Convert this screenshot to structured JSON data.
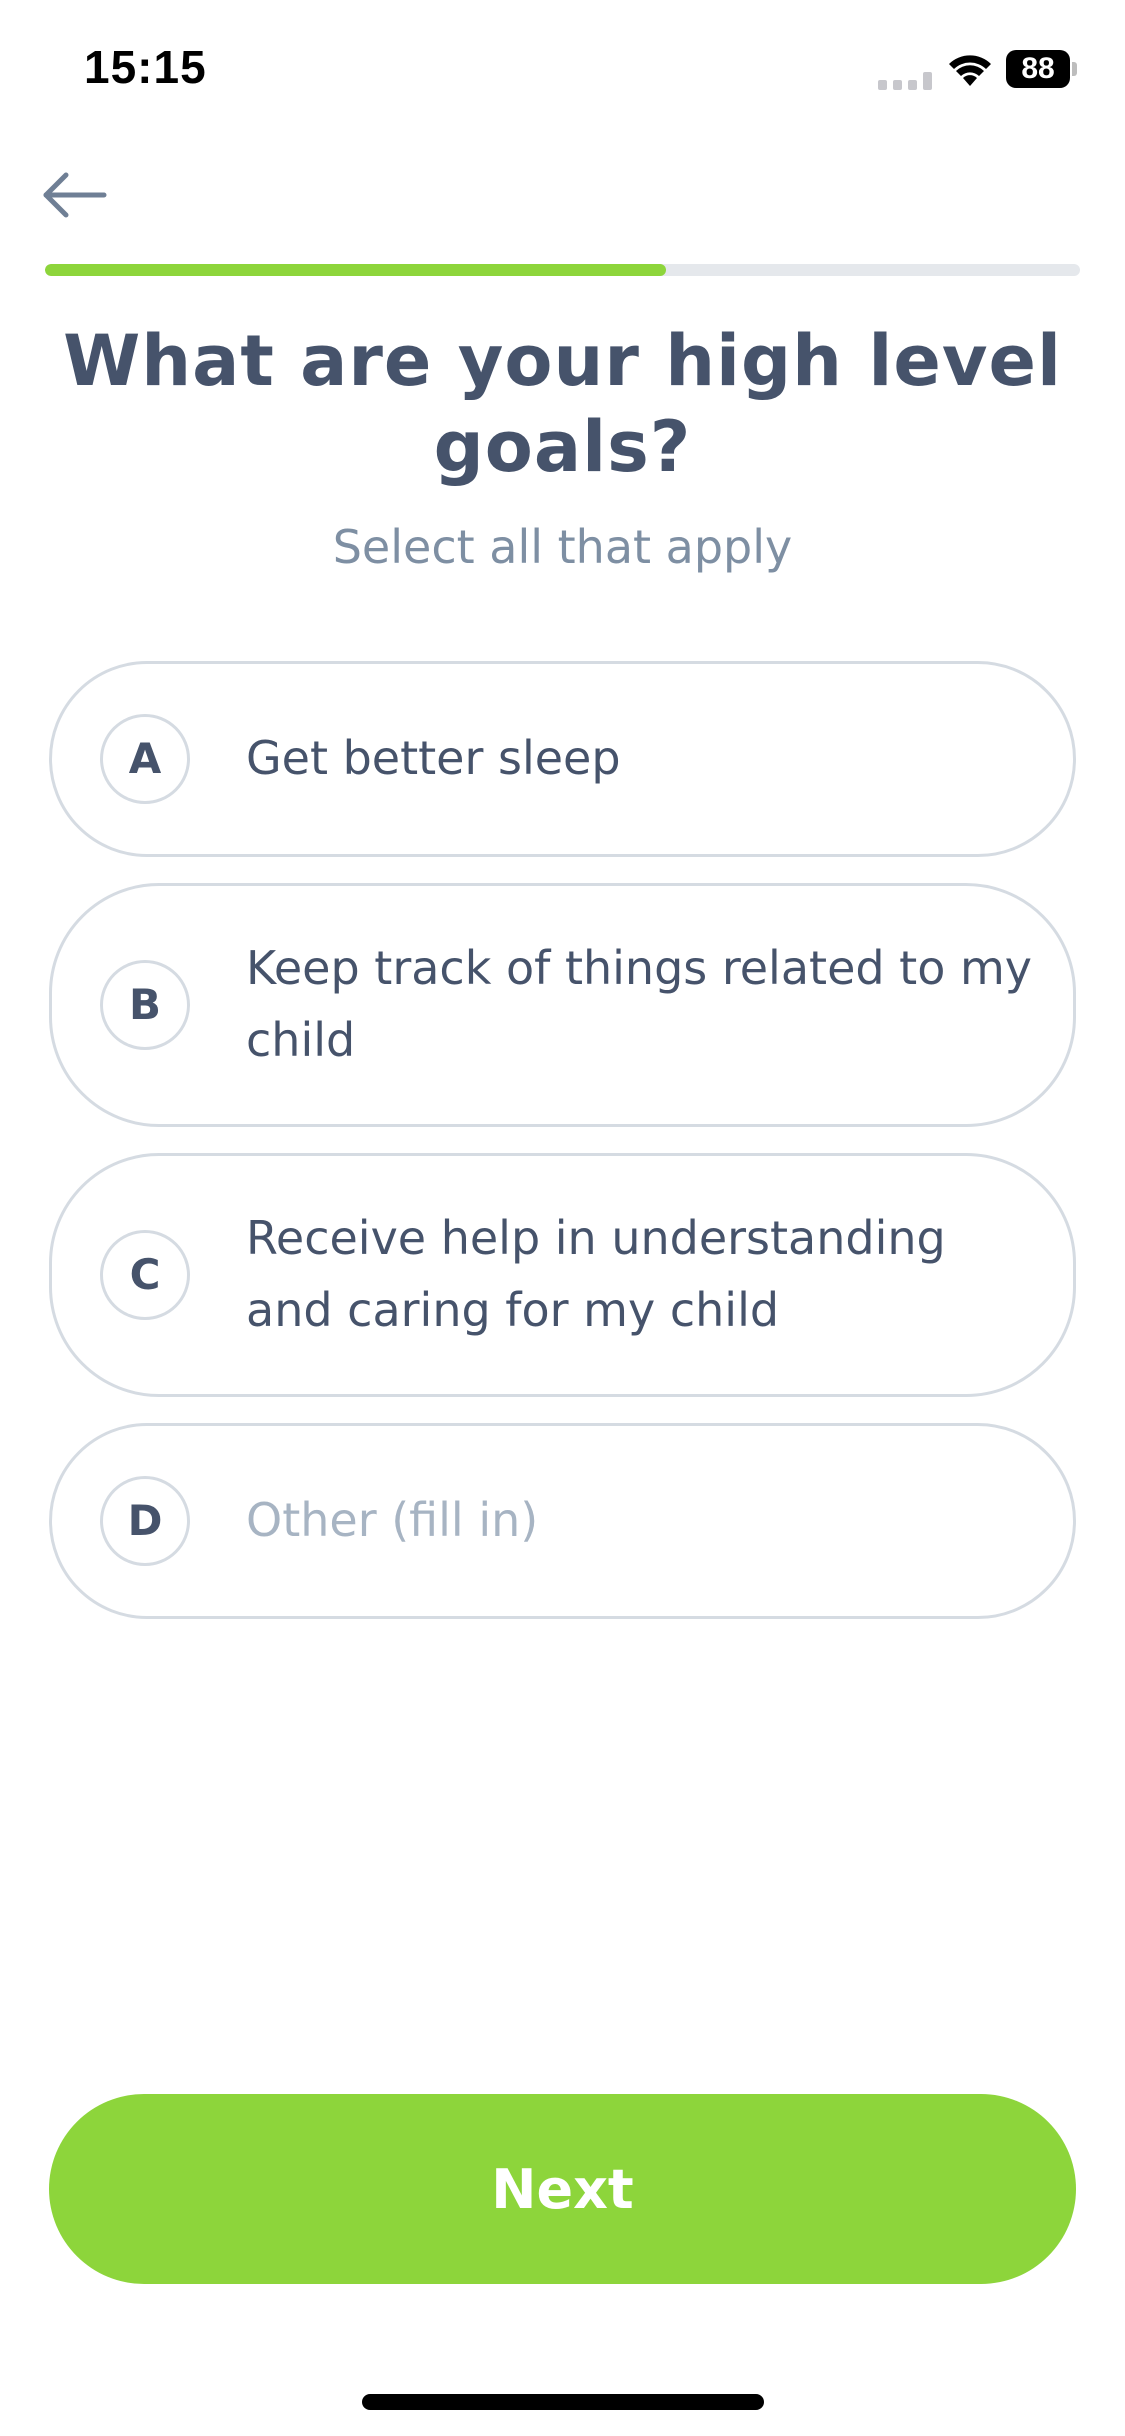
{
  "status_bar": {
    "time": "15:15",
    "battery_level": "88",
    "icons": [
      "signal-icon",
      "wifi-icon",
      "battery-icon"
    ]
  },
  "navigation": {
    "back_icon": "arrow-left-icon"
  },
  "progress": {
    "value": 0.6
  },
  "question": {
    "title": "What are your high level goals?",
    "subtitle": "Select all that apply"
  },
  "options": [
    {
      "letter": "A",
      "label": "Get better sleep"
    },
    {
      "letter": "B",
      "label": "Keep track of things related to my child"
    },
    {
      "letter": "C",
      "label": "Receive help in understanding and caring for my child"
    },
    {
      "letter": "D",
      "placeholder": "Other (fill in)",
      "value": ""
    }
  ],
  "actions": {
    "next_label": "Next"
  },
  "colors": {
    "accent": "#8dd53b",
    "text": "#46536b",
    "subtitle": "#7e8fa3",
    "placeholder": "#a7b4c3",
    "border": "#d5dbe2"
  }
}
